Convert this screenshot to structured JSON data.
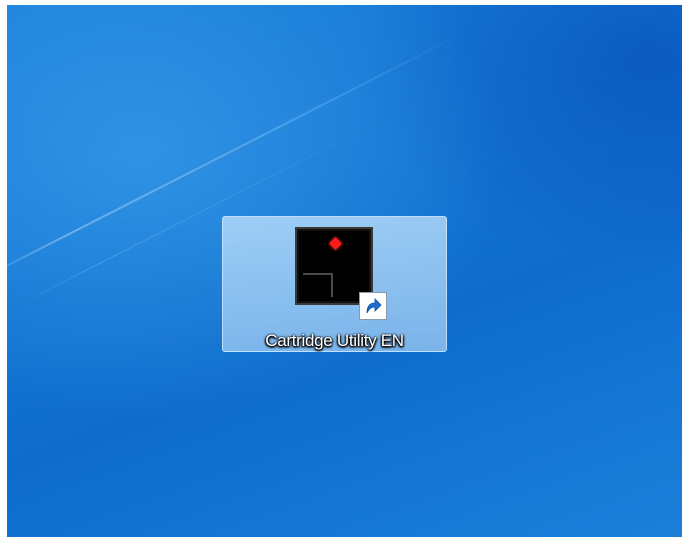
{
  "desktop": {
    "shortcuts": [
      {
        "label": "Cartridge Utility EN",
        "icon": "cartridge-utility-app-icon",
        "overlay_icon": "shortcut-arrow-icon",
        "selected": true
      }
    ]
  },
  "colors": {
    "desktop_blue": "#1475d3",
    "selection_highlight": "#bee1fc",
    "icon_background": "#000000",
    "icon_accent": "#ff1a1a",
    "label_text": "#ffffff"
  }
}
